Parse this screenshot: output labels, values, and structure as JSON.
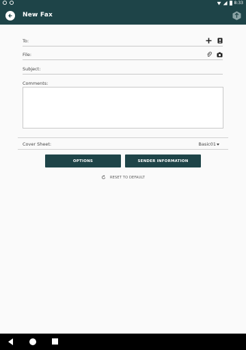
{
  "status_bar": {
    "time": "8:33",
    "icons": [
      "notification-icon",
      "notification-icon",
      "wifi-icon",
      "signal-icon",
      "battery-icon"
    ]
  },
  "app_bar": {
    "title": "New Fax",
    "back_icon": "back-arrow-icon",
    "send_icon": "send-fax-icon",
    "color": "#1e4448"
  },
  "form": {
    "to_label": "To:",
    "file_label": "File:",
    "subject_label": "Subject:",
    "comments_label": "Comments:",
    "to_icons": [
      "plus-icon",
      "contacts-icon"
    ],
    "file_icons": [
      "paperclip-icon",
      "camera-icon"
    ]
  },
  "cover_sheet": {
    "label": "Cover Sheet:",
    "value": "Basic01"
  },
  "buttons": {
    "options": "OPTIONS",
    "sender_information": "SENDER INFORMATION",
    "reset": "RESET TO DEFAULT"
  },
  "nav": {
    "icons": [
      "nav-back-icon",
      "nav-home-icon",
      "nav-recents-icon"
    ]
  }
}
